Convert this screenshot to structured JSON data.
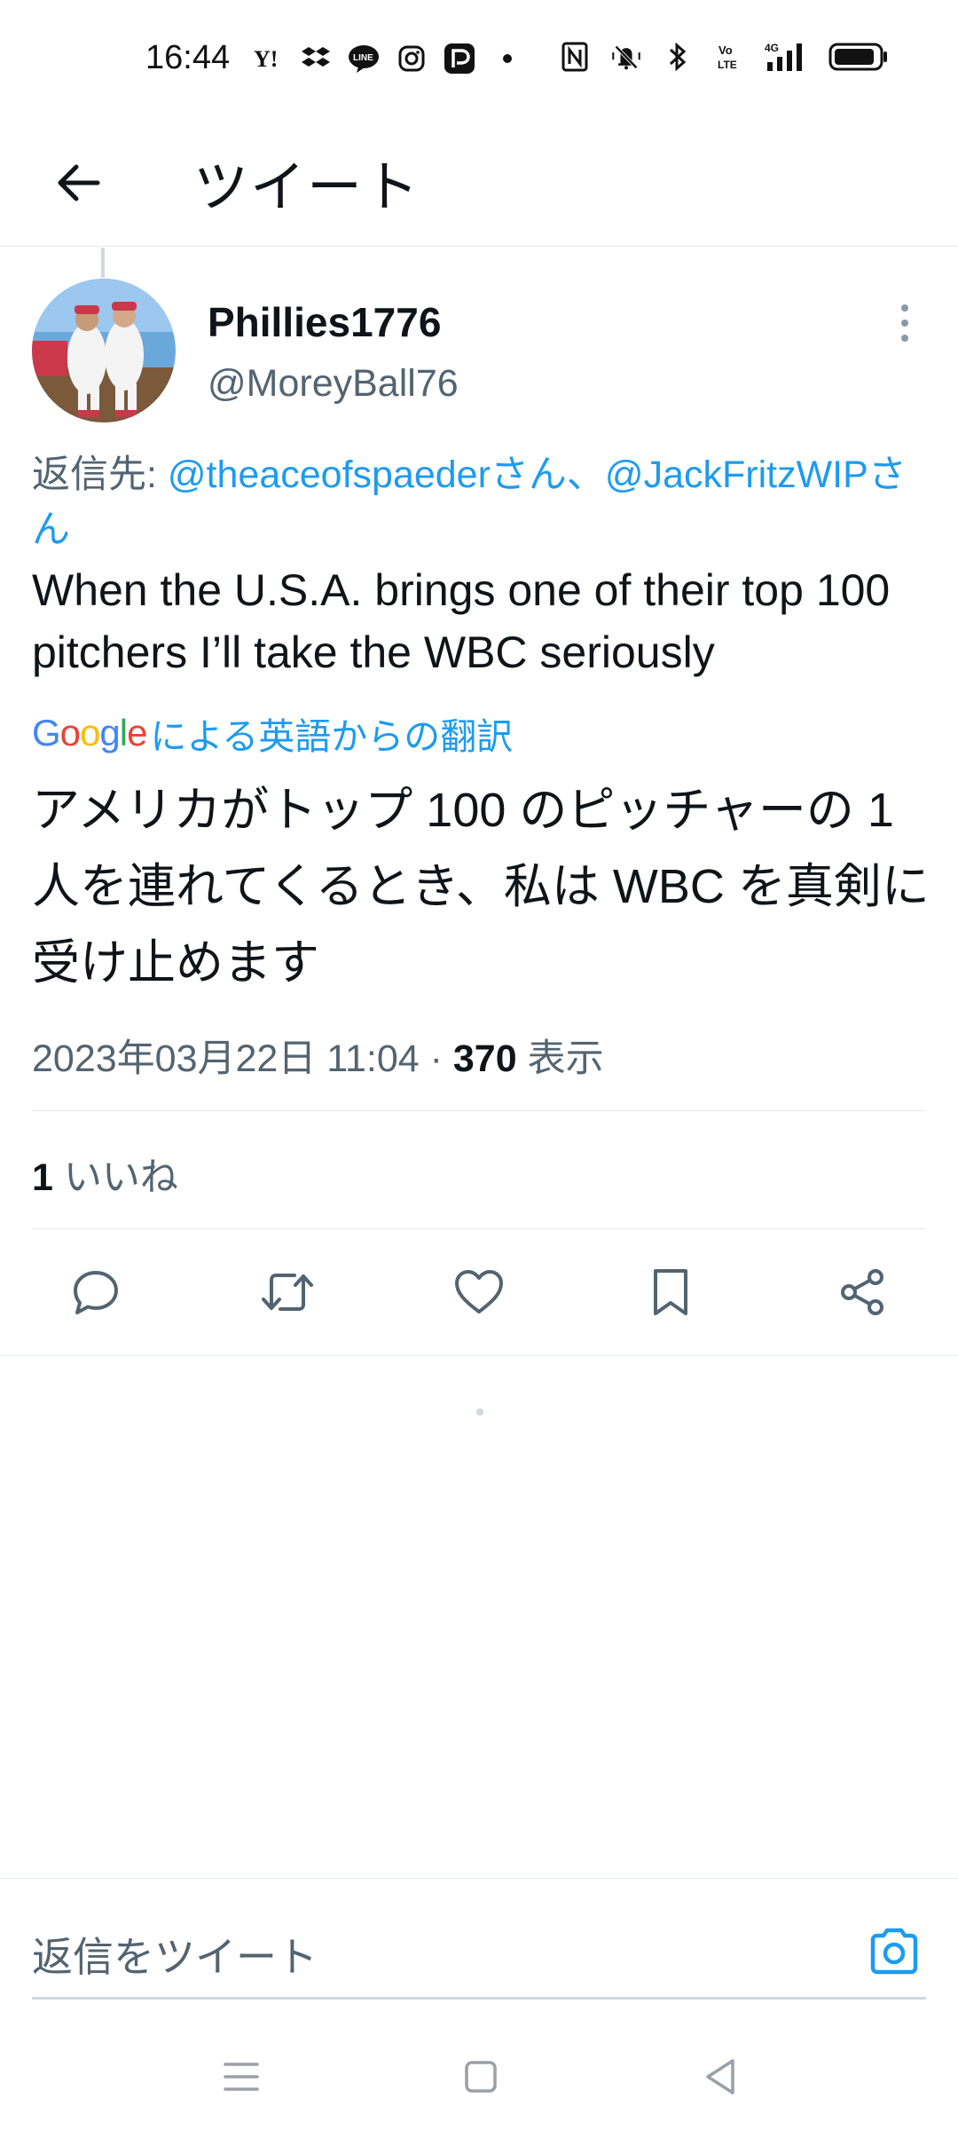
{
  "status_bar": {
    "time": "16:44",
    "left_icons": [
      "yahoo-icon",
      "dropbox-icon",
      "line-icon",
      "instagram-icon",
      "paypay-icon",
      "dot-icon"
    ],
    "right_icons": [
      "nfc-icon",
      "mute-icon",
      "bluetooth-icon",
      "volte-icon",
      "signal-4g-icon",
      "battery-icon"
    ]
  },
  "header": {
    "title": "ツイート"
  },
  "tweet": {
    "display_name": "Phillies1776",
    "handle": "@MoreyBall76",
    "reply_prefix": "返信先: ",
    "reply_mention_1": "@theaceofspaederさん",
    "reply_separator": "、",
    "reply_mention_2": "@JackFritzWIPさん",
    "text": "When the U.S.A. brings one of their top 100 pitchers I’ll take the WBC seriously",
    "translate_label": "による英語からの翻訳",
    "google_letters": [
      "G",
      "o",
      "o",
      "g",
      "l",
      "e"
    ],
    "translated_text": "アメリカがトップ 100 のピッチャーの 1 人を連れてくるとき、私は WBC を真剣に受け止めます",
    "timestamp": "2023年03月22日 11:04 · ",
    "views_count": "370",
    "views_label": " 表示",
    "likes_count": "1",
    "likes_label": " いいね"
  },
  "composer": {
    "placeholder": "返信をツイート"
  },
  "colors": {
    "accent": "#1d9bf0",
    "text_primary": "#0f1419",
    "text_secondary": "#536471",
    "divider": "#e6e9ec"
  }
}
